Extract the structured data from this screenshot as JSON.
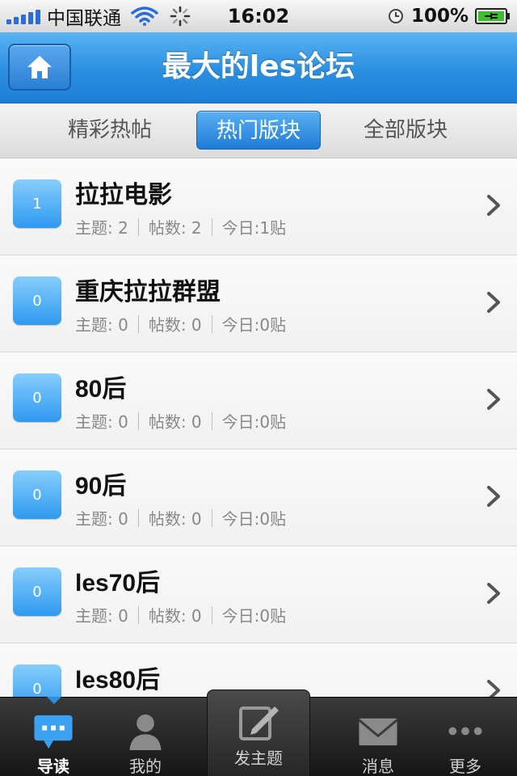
{
  "status_bar": {
    "carrier": "中国联通",
    "time": "16:02",
    "battery": "100%"
  },
  "nav": {
    "title": "最大的les论坛",
    "home_icon": "home-icon"
  },
  "tabs": [
    {
      "label": "精彩热帖",
      "active": false
    },
    {
      "label": "热门版块",
      "active": true
    },
    {
      "label": "全部版块",
      "active": false
    }
  ],
  "forums": [
    {
      "badge": "1",
      "name": "拉拉电影",
      "topics": "主题: 2",
      "posts": "帖数: 2",
      "today": "今日:1贴"
    },
    {
      "badge": "0",
      "name": "重庆拉拉群盟",
      "topics": "主题: 0",
      "posts": "帖数: 0",
      "today": "今日:0贴"
    },
    {
      "badge": "0",
      "name": "80后",
      "topics": "主题: 0",
      "posts": "帖数: 0",
      "today": "今日:0贴"
    },
    {
      "badge": "0",
      "name": "90后",
      "topics": "主题: 0",
      "posts": "帖数: 0",
      "today": "今日:0贴"
    },
    {
      "badge": "0",
      "name": "les70后",
      "topics": "主题: 0",
      "posts": "帖数: 0",
      "today": "今日:0贴"
    },
    {
      "badge": "0",
      "name": "les80后",
      "topics": "",
      "posts": "",
      "today": ""
    }
  ],
  "tabbar": [
    {
      "label": "导读",
      "icon": "chat-bubble-icon",
      "active": true
    },
    {
      "label": "我的",
      "icon": "person-icon",
      "active": false
    },
    {
      "label": "发主题",
      "icon": "compose-icon",
      "active": false
    },
    {
      "label": "消息",
      "icon": "envelope-icon",
      "active": false
    },
    {
      "label": "更多",
      "icon": "more-dots-icon",
      "active": false
    }
  ],
  "colors": {
    "accent": "#2b8fe0",
    "badge": "#2e9af0",
    "tabbar": "#1f1f1f"
  }
}
